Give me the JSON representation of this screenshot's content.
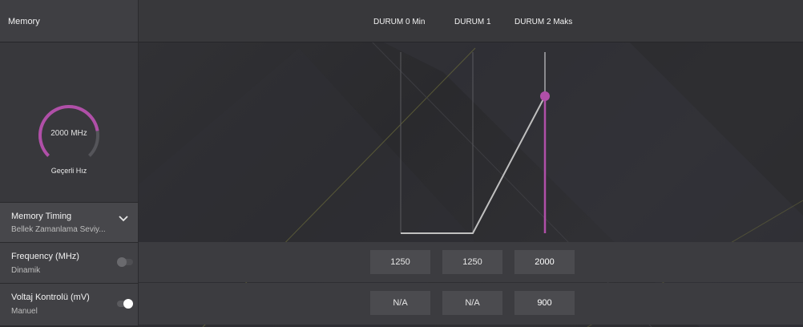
{
  "header": {
    "title": "Memory"
  },
  "columns": [
    "DURUM 0 Min",
    "DURUM 1",
    "DURUM 2 Maks"
  ],
  "gauge": {
    "value_text": "2000 MHz",
    "label": "Geçerli Hız",
    "fraction": 0.8
  },
  "memory_timing": {
    "title": "Memory Timing",
    "value": "Bellek Zamanlama Seviy..."
  },
  "frequency": {
    "title": "Frequency (MHz)",
    "mode": "Dinamik",
    "toggle_on": false,
    "values": [
      "1250",
      "1250",
      "2000"
    ]
  },
  "voltage": {
    "title": "Voltaj Kontrolü (mV)",
    "mode": "Manuel",
    "toggle_on": true,
    "values": [
      "N/A",
      "N/A",
      "900"
    ]
  },
  "colors": {
    "accent": "#b04fa8",
    "line": "#b8b8b8"
  }
}
